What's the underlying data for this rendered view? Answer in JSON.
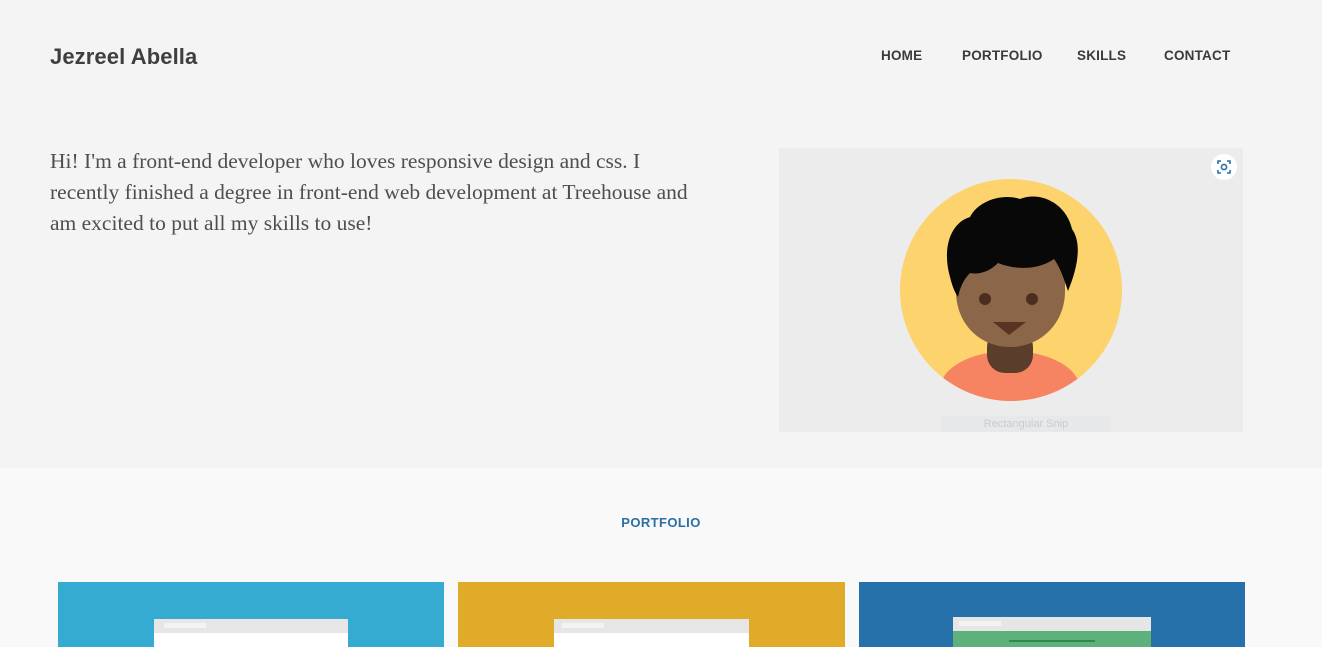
{
  "header": {
    "site_title": "Jezreel Abella",
    "nav": {
      "home": "HOME",
      "portfolio": "PORTFOLIO",
      "skills": "SKILLS",
      "contact": "CONTACT"
    }
  },
  "intro": {
    "text": "Hi! I'm a front-end developer who loves responsive design and css. I recently finished a degree in front-end web development at Treehouse and am excited to put all my skills to use!"
  },
  "hero": {
    "snip_caption": "Rectangular Snip",
    "snip_icon": "screen-capture-icon",
    "avatar_icon": "person-avatar-icon"
  },
  "portfolio": {
    "heading": "PORTFOLIO",
    "tiles": [
      {
        "color": "#36abd2"
      },
      {
        "color": "#dfab29"
      },
      {
        "color": "#2771aa"
      }
    ]
  },
  "colors": {
    "background": "#f4f4f4",
    "section_background": "#f9f9f9",
    "accent": "#2a6fa6",
    "avatar_circle": "#fdd36d",
    "avatar_skin": "#8c6649",
    "avatar_shirt": "#f68362"
  }
}
